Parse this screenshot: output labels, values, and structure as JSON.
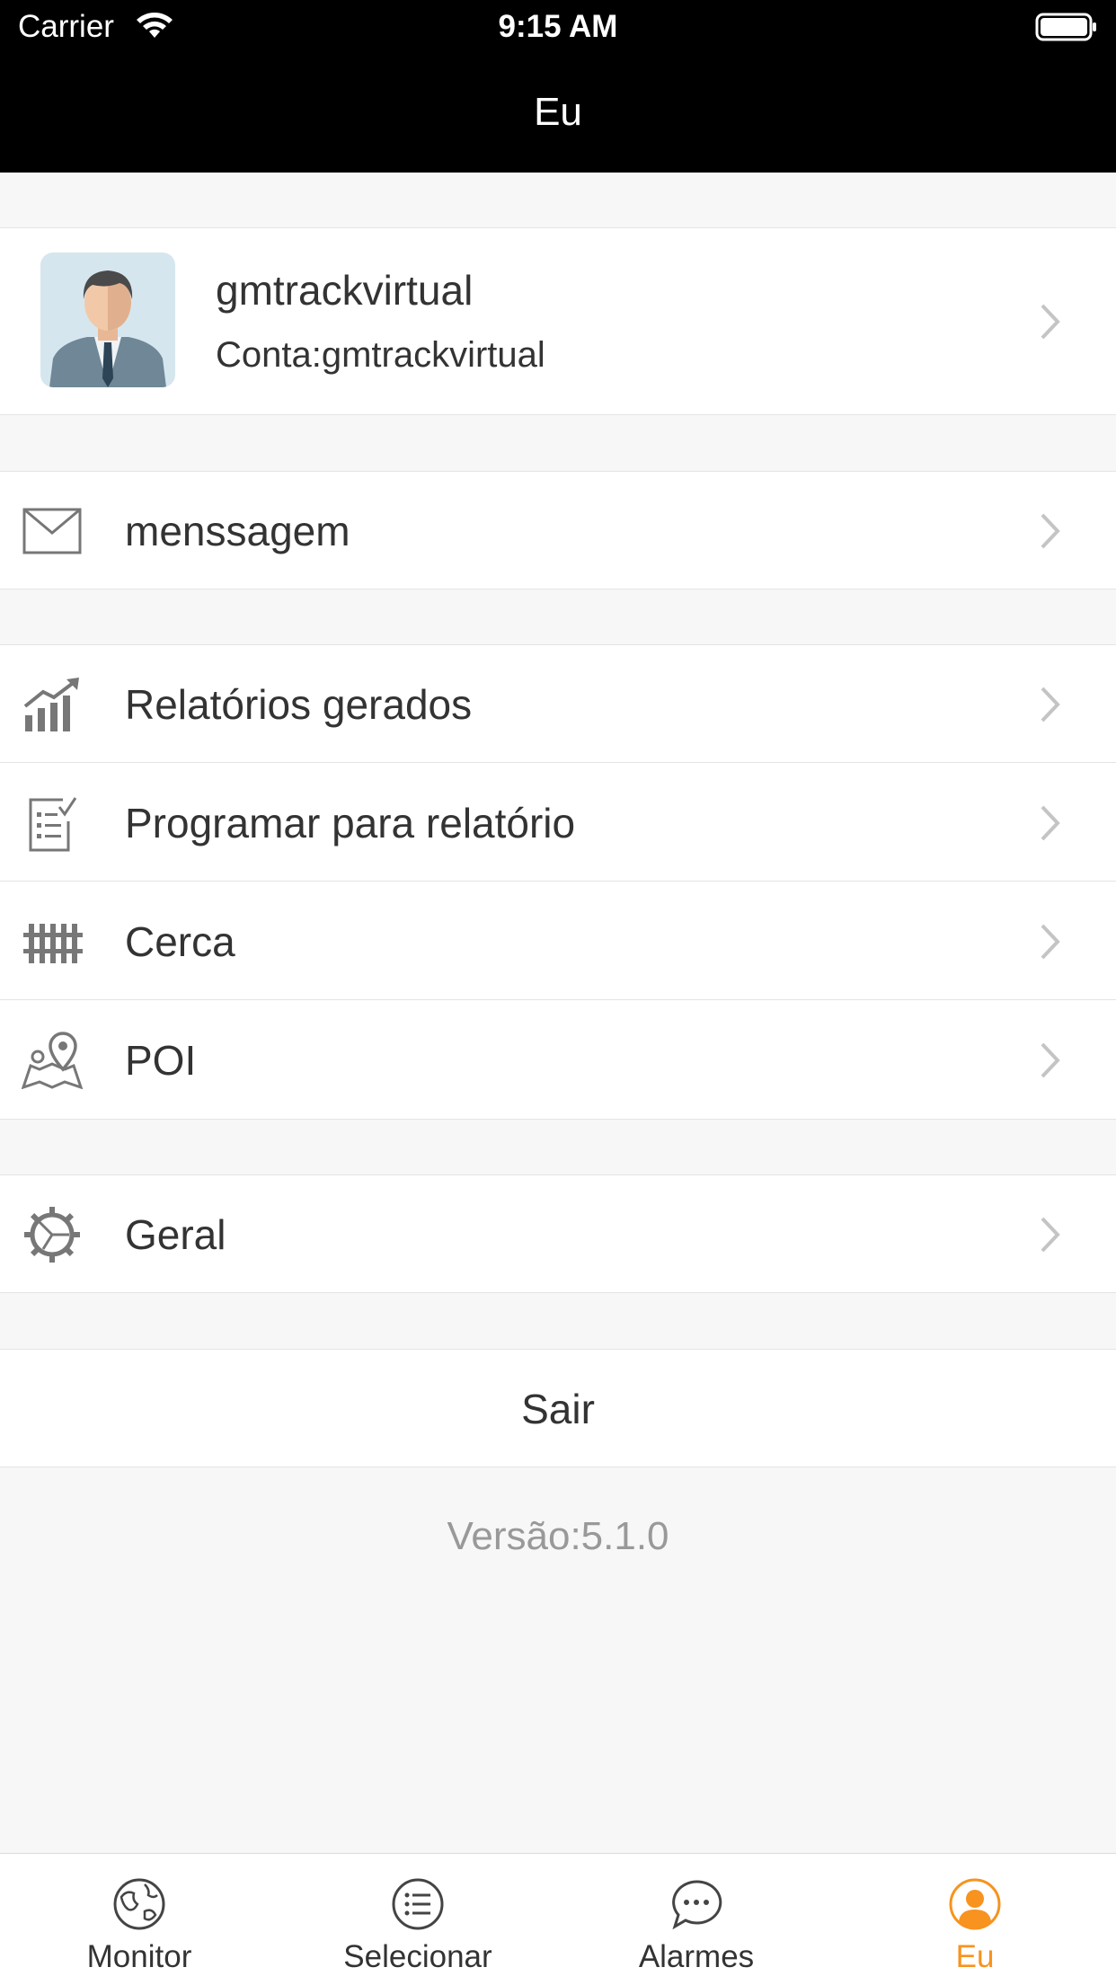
{
  "status_bar": {
    "carrier": "Carrier",
    "time": "9:15 AM"
  },
  "nav": {
    "title": "Eu"
  },
  "profile": {
    "name": "gmtrackvirtual",
    "account": "Conta:gmtrackvirtual"
  },
  "menu": {
    "message": "menssagem",
    "reports": "Relatórios gerados",
    "schedule_report": "Programar para relatório",
    "fence": "Cerca",
    "poi": "POI",
    "general": "Geral"
  },
  "logout": "Sair",
  "version": "Versão:5.1.0",
  "tabs": [
    {
      "label": "Monitor",
      "icon": "globe-icon"
    },
    {
      "label": "Selecionar",
      "icon": "list-icon"
    },
    {
      "label": "Alarmes",
      "icon": "chat-bubble-icon"
    },
    {
      "label": "Eu",
      "icon": "person-icon",
      "active": true
    }
  ],
  "colors": {
    "accent": "#f7931e",
    "nav_bg": "#000000",
    "page_bg": "#f7f7f7"
  }
}
